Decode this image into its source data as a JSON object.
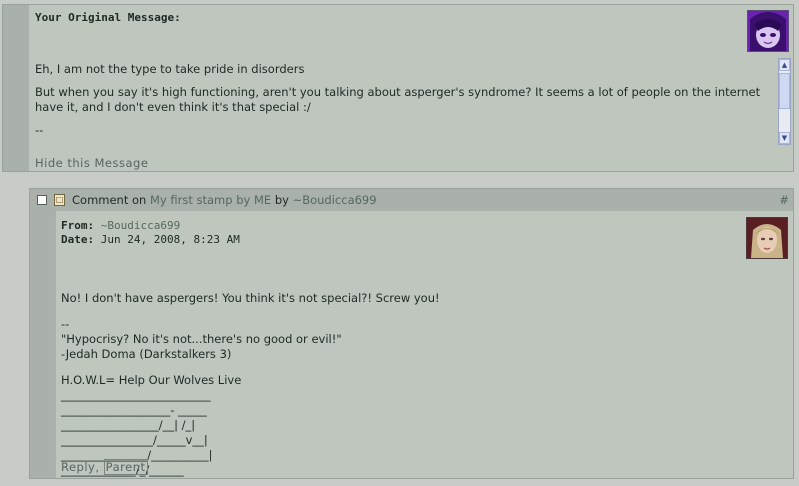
{
  "original_message": {
    "title": "Your Original Message:",
    "paragraphs": [
      "Eh, I am not the type to take pride in disorders",
      "But when you say it's high functioning, aren't you talking about asperger's syndrome? It seems a lot of people on the internet have it, and I don't even think it's that special :/",
      "--"
    ],
    "hide_label": "Hide this Message",
    "scroll_up_icon": "arrow-up-icon",
    "scroll_down_icon": "arrow-down-icon"
  },
  "comment": {
    "prefix": "Comment",
    "on_word": "on",
    "deviation_title": "My first stamp by ME",
    "by_word": "by",
    "author": "~Boudicca699",
    "hash": "#",
    "from_label": "From:",
    "from_value": "~Boudicca699",
    "date_label": "Date:",
    "date_value": "Jun 24, 2008, 8:23 AM",
    "message": "No! I don't have aspergers! You think it's not special?! Screw you!",
    "signature": [
      "--",
      "\"Hypocrisy? No it's not...there's no good or evil!\"",
      "-Jedah Doma (Darkstalkers 3)"
    ],
    "howl": "H.O.W.L= Help Our Wolves Live",
    "ascii_art": [
      "__________________________",
      "___________________- _____",
      "_________________/__| /_|",
      "________________/_____v__|",
      "_______________/__________|",
      "_____________/_/______"
    ],
    "reply_label": "Reply,",
    "parent_label": "Parent"
  },
  "colors": {
    "page_bg": "#c7cdc6",
    "panel_frame": "#a9b1aa",
    "panel_body": "#bec6be",
    "muted_text": "#55685c"
  }
}
